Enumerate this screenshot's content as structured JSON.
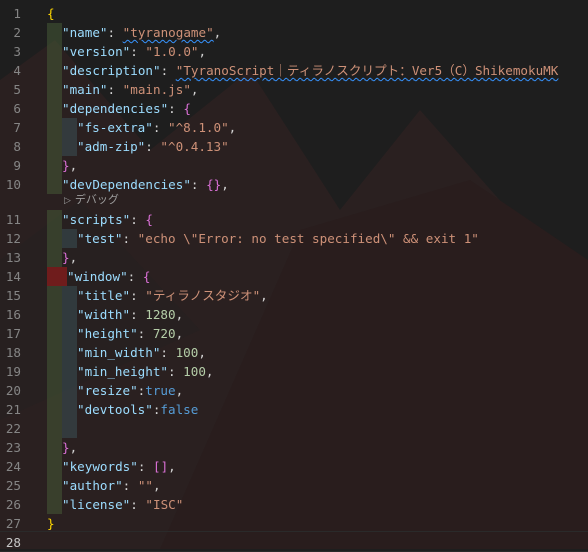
{
  "editor": {
    "codelens_label": "デバッグ",
    "codelens_icon": "debug-play-icon",
    "lines": [
      {
        "num": "1",
        "ind": "",
        "toks": [
          [
            "br1",
            "{"
          ]
        ]
      },
      {
        "num": "2",
        "ind": "g",
        "toks": [
          [
            "k",
            "\"name\""
          ],
          [
            "p",
            ": "
          ],
          [
            "s sq",
            "\"tyranogame\""
          ],
          [
            "p",
            ","
          ]
        ]
      },
      {
        "num": "3",
        "ind": "g",
        "toks": [
          [
            "k",
            "\"version\""
          ],
          [
            "p",
            ": "
          ],
          [
            "s",
            "\"1.0.0\""
          ],
          [
            "p",
            ","
          ]
        ]
      },
      {
        "num": "4",
        "ind": "g",
        "toks": [
          [
            "k",
            "\"description\""
          ],
          [
            "p",
            ": "
          ],
          [
            "s sq",
            "\"TyranoScript｜ティラノスクリプト：Ver5（C）ShikemokuMK"
          ]
        ]
      },
      {
        "num": "5",
        "ind": "g",
        "toks": [
          [
            "k",
            "\"main\""
          ],
          [
            "p",
            ": "
          ],
          [
            "s",
            "\"main.js\""
          ],
          [
            "p",
            ","
          ]
        ]
      },
      {
        "num": "6",
        "ind": "g",
        "toks": [
          [
            "k",
            "\"dependencies\""
          ],
          [
            "p",
            ": "
          ],
          [
            "br2",
            "{"
          ]
        ]
      },
      {
        "num": "7",
        "ind": "gb",
        "toks": [
          [
            "k",
            "\"fs-extra\""
          ],
          [
            "p",
            ": "
          ],
          [
            "s",
            "\"^8.1.0\""
          ],
          [
            "p",
            ","
          ]
        ]
      },
      {
        "num": "8",
        "ind": "gb",
        "toks": [
          [
            "k",
            "\"adm-zip\""
          ],
          [
            "p",
            ": "
          ],
          [
            "s",
            "\"^0.4.13\""
          ]
        ]
      },
      {
        "num": "9",
        "ind": "g",
        "toks": [
          [
            "br2",
            "}"
          ],
          [
            "p",
            ","
          ]
        ]
      },
      {
        "num": "10",
        "ind": "g",
        "toks": [
          [
            "k",
            "\"devDependencies\""
          ],
          [
            "p",
            ": "
          ],
          [
            "br2",
            "{}"
          ],
          [
            "p",
            ","
          ]
        ]
      },
      {
        "num": "11",
        "ind": "g",
        "toks": [
          [
            "k",
            "\"scripts\""
          ],
          [
            "p",
            ": "
          ],
          [
            "br2",
            "{"
          ]
        ]
      },
      {
        "num": "12",
        "ind": "gb",
        "toks": [
          [
            "k",
            "\"test\""
          ],
          [
            "p",
            ": "
          ],
          [
            "s",
            "\"echo \\\"Error: no test specified\\\" && exit 1\""
          ]
        ]
      },
      {
        "num": "13",
        "ind": "g",
        "toks": [
          [
            "br2",
            "}"
          ],
          [
            "p",
            ","
          ]
        ]
      },
      {
        "num": "14",
        "ind": "r",
        "toks": [
          [
            "k",
            "\"window\""
          ],
          [
            "p",
            ": "
          ],
          [
            "br2",
            "{"
          ]
        ]
      },
      {
        "num": "15",
        "ind": "gb",
        "toks": [
          [
            "k",
            "\"title\""
          ],
          [
            "p",
            ": "
          ],
          [
            "s",
            "\"ティラノスタジオ\""
          ],
          [
            "p",
            ","
          ]
        ]
      },
      {
        "num": "16",
        "ind": "gb",
        "toks": [
          [
            "k",
            "\"width\""
          ],
          [
            "p",
            ": "
          ],
          [
            "n",
            "1280"
          ],
          [
            "p",
            ","
          ]
        ]
      },
      {
        "num": "17",
        "ind": "gb",
        "toks": [
          [
            "k",
            "\"height\""
          ],
          [
            "p",
            ": "
          ],
          [
            "n",
            "720"
          ],
          [
            "p",
            ","
          ]
        ]
      },
      {
        "num": "18",
        "ind": "gb",
        "toks": [
          [
            "k",
            "\"min_width\""
          ],
          [
            "p",
            ": "
          ],
          [
            "n",
            "100"
          ],
          [
            "p",
            ","
          ]
        ]
      },
      {
        "num": "19",
        "ind": "gb",
        "toks": [
          [
            "k",
            "\"min_height\""
          ],
          [
            "p",
            ": "
          ],
          [
            "n",
            "100"
          ],
          [
            "p",
            ","
          ]
        ]
      },
      {
        "num": "20",
        "ind": "gb",
        "toks": [
          [
            "k",
            "\"resize\""
          ],
          [
            "p",
            ":"
          ],
          [
            "b",
            "true"
          ],
          [
            "p",
            ","
          ]
        ]
      },
      {
        "num": "21",
        "ind": "gb",
        "toks": [
          [
            "k",
            "\"devtools\""
          ],
          [
            "p",
            ":"
          ],
          [
            "b",
            "false"
          ]
        ]
      },
      {
        "num": "22",
        "ind": "gb",
        "toks": []
      },
      {
        "num": "23",
        "ind": "g",
        "toks": [
          [
            "br2",
            "}"
          ],
          [
            "p",
            ","
          ]
        ]
      },
      {
        "num": "24",
        "ind": "g",
        "toks": [
          [
            "k",
            "\"keywords\""
          ],
          [
            "p",
            ": "
          ],
          [
            "br2",
            "[]"
          ],
          [
            "p",
            ","
          ]
        ]
      },
      {
        "num": "25",
        "ind": "g",
        "toks": [
          [
            "k",
            "\"author\""
          ],
          [
            "p",
            ": "
          ],
          [
            "s",
            "\"\""
          ],
          [
            "p",
            ","
          ]
        ]
      },
      {
        "num": "26",
        "ind": "g",
        "toks": [
          [
            "k",
            "\"license\""
          ],
          [
            "p",
            ": "
          ],
          [
            "s",
            "\"ISC\""
          ]
        ]
      },
      {
        "num": "27",
        "ind": "",
        "toks": [
          [
            "br1",
            "}"
          ]
        ]
      },
      {
        "num": "28",
        "ind": "",
        "toks": []
      }
    ]
  }
}
